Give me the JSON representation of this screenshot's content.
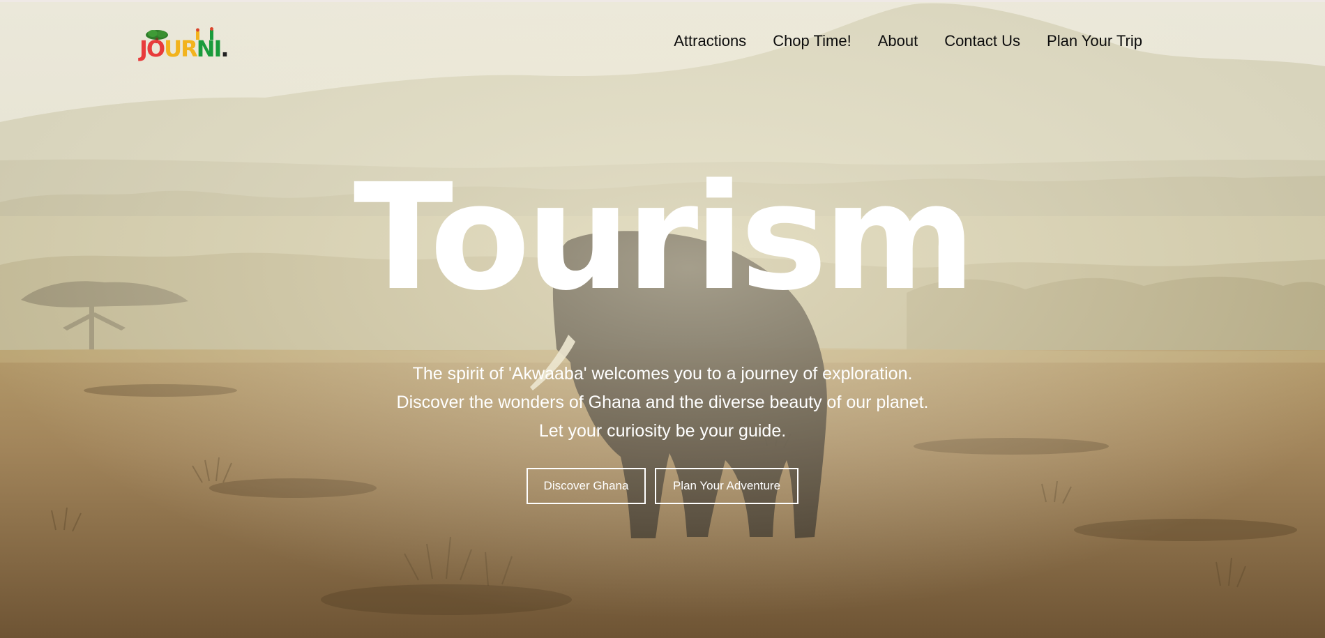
{
  "logo": {
    "letters": [
      "J",
      "O",
      "U",
      "R",
      "N",
      "I"
    ],
    "dot": "."
  },
  "nav": {
    "items": [
      {
        "label": "Attractions"
      },
      {
        "label": "Chop Time!"
      },
      {
        "label": "About"
      },
      {
        "label": "Contact Us"
      },
      {
        "label": "Plan Your Trip"
      }
    ]
  },
  "hero": {
    "title": "Tourism",
    "tagline": [
      "The spirit of 'Akwaaba' welcomes you to a journey of exploration.",
      "Discover the wonders of Ghana and the diverse beauty of our planet.",
      "Let your curiosity be your guide."
    ],
    "buttons": {
      "primary": "Discover Ghana",
      "secondary": "Plan Your Adventure"
    }
  },
  "colors": {
    "logo_red": "#e83b3b",
    "logo_yellow": "#f2b31d",
    "logo_green": "#1a9b3c",
    "nav_text": "#0c0c0c",
    "hero_text": "#ffffff"
  }
}
